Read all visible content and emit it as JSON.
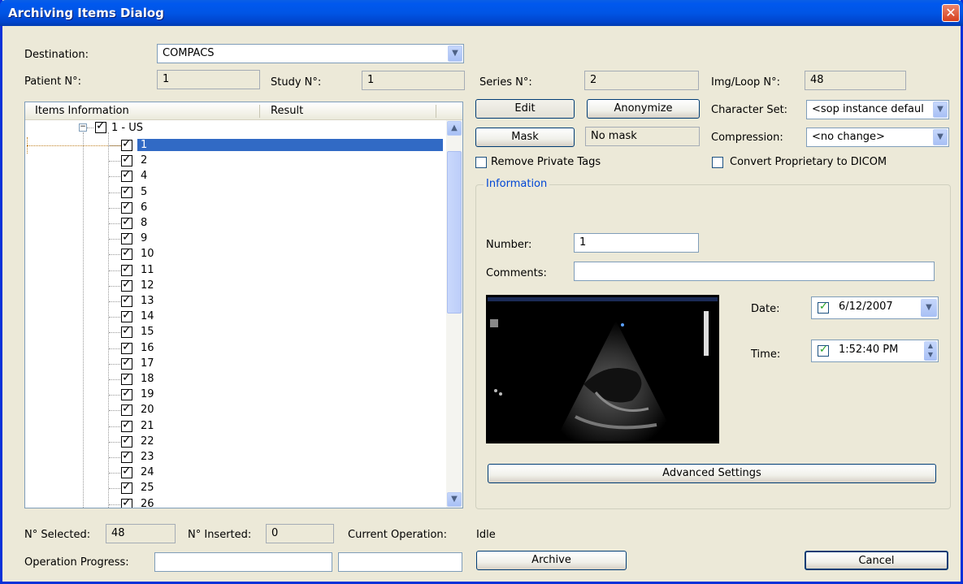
{
  "window": {
    "title": "Archiving Items Dialog",
    "close_label": "✕"
  },
  "destination": {
    "label": "Destination:",
    "value": "COMPACS"
  },
  "patient": {
    "label": "Patient N°:",
    "value": "1"
  },
  "study": {
    "label": "Study N°:",
    "value": "1"
  },
  "series": {
    "label": "Series N°:",
    "value": "2"
  },
  "imgloop": {
    "label": "Img/Loop N°:",
    "value": "48"
  },
  "tree": {
    "col_items": "Items Information",
    "col_result": "Result",
    "root_label": "1 - US",
    "items": [
      "1",
      "2",
      "4",
      "5",
      "6",
      "8",
      "9",
      "10",
      "11",
      "12",
      "13",
      "14",
      "15",
      "16",
      "17",
      "18",
      "19",
      "20",
      "21",
      "22",
      "23",
      "24",
      "25",
      "26"
    ],
    "selected_item": "1"
  },
  "buttons": {
    "edit": "Edit",
    "anonymize": "Anonymize",
    "mask": "Mask",
    "advanced": "Advanced Settings",
    "archive": "Archive",
    "cancel": "Cancel"
  },
  "mask_status": "No mask",
  "charset": {
    "label": "Character Set:",
    "value": "<sop instance defaul"
  },
  "compression": {
    "label": "Compression:",
    "value": "<no change>"
  },
  "remove_private_tags": {
    "label": "Remove Private Tags",
    "checked": false
  },
  "convert_proprietary": {
    "label": "Convert Proprietary to DICOM",
    "checked": false
  },
  "information": {
    "title": "Information",
    "number_label": "Number:",
    "number_value": "1",
    "comments_label": "Comments:",
    "comments_value": "",
    "date_label": "Date:",
    "date_value": "6/12/2007",
    "date_checked": true,
    "time_label": "Time:",
    "time_value": "1:52:40 PM",
    "time_checked": true
  },
  "footer": {
    "selected_label": "N° Selected:",
    "selected_value": "48",
    "inserted_label": "N° Inserted:",
    "inserted_value": "0",
    "current_op_label": "Current Operation:",
    "current_op_value": "Idle",
    "progress_label": "Operation Progress:",
    "progress1": 0,
    "progress2": 0
  },
  "colors": {
    "titlebar": "#0055e5",
    "selection": "#316ac5",
    "dialog_bg": "#ece9d8",
    "group_title": "#0046d5"
  }
}
